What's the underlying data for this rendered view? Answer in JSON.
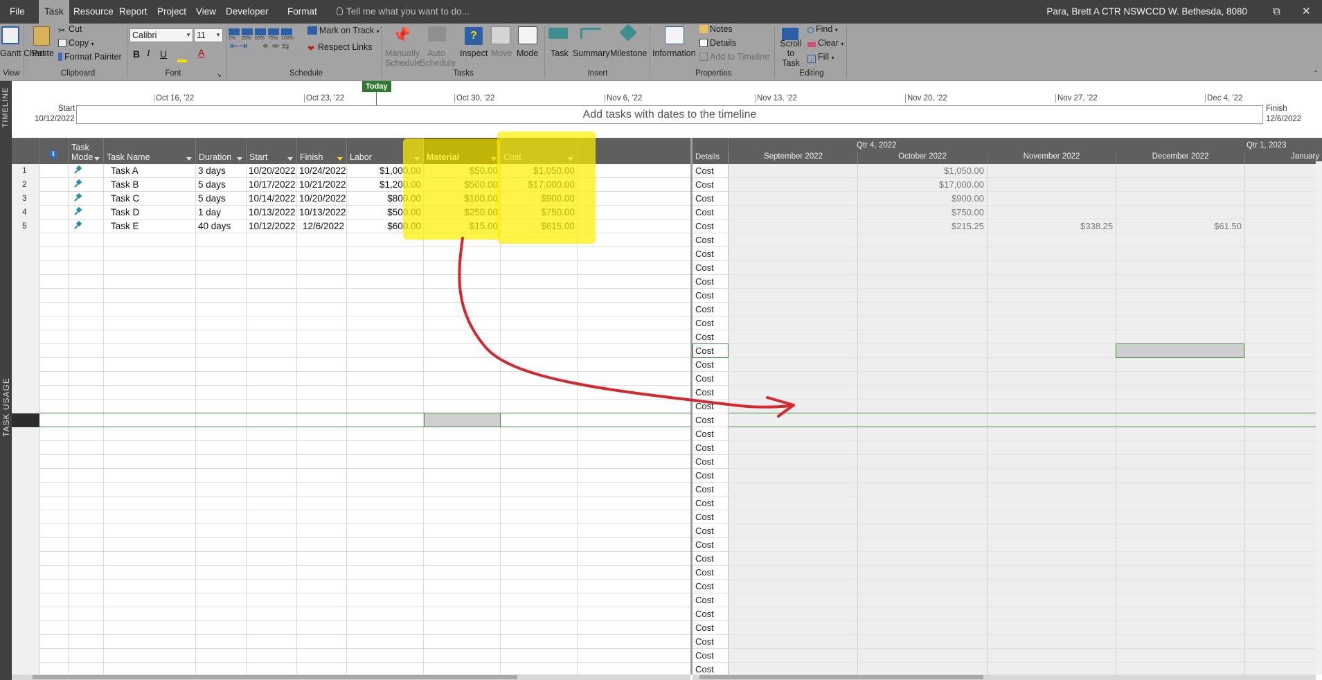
{
  "menu": {
    "items": [
      "File",
      "Task",
      "Resource",
      "Report",
      "Project",
      "View",
      "Developer",
      "Format"
    ],
    "active": "Task",
    "tell_me": "Tell me what you want to do...",
    "user": "Para, Brett A CTR NSWCCD W. Bethesda, 8080"
  },
  "ribbon": {
    "groups": {
      "view": "View",
      "clipboard": "Clipboard",
      "font": "Font",
      "schedule": "Schedule",
      "tasks": "Tasks",
      "insert": "Insert",
      "properties": "Properties",
      "editing": "Editing"
    },
    "gantt_chart": "Gantt Chart",
    "paste": "Paste",
    "cut": "Cut",
    "copy": "Copy",
    "format_painter": "Format Painter",
    "font_name": "Calibri",
    "font_size": "11",
    "mark_on_track": "Mark on Track",
    "respect_links": "Respect Links",
    "manually_schedule": "Manually Schedule",
    "auto_schedule": "Auto Schedule",
    "inspect": "Inspect",
    "move": "Move",
    "mode": "Mode",
    "task": "Task",
    "summary": "Summary",
    "milestone": "Milestone",
    "information": "Information",
    "notes": "Notes",
    "details": "Details",
    "add_to_timeline": "Add to Timeline",
    "scroll_to_task": "Scroll to Task",
    "find": "Find",
    "clear": "Clear",
    "fill": "Fill",
    "bold": "B",
    "italic": "I",
    "underline": "U",
    "font_color": "A",
    "pct": [
      "0%",
      "25%",
      "50%",
      "75%",
      "100%"
    ]
  },
  "timeline": {
    "side_label": "TIMELINE",
    "today": "Today",
    "start_label": "Start",
    "start_date": "10/12/2022",
    "finish_label": "Finish",
    "finish_date": "12/6/2022",
    "placeholder": "Add tasks with dates to the timeline",
    "dates": [
      "Oct 16, '22",
      "Oct 23, '22",
      "Oct 30, '22",
      "Nov 6, '22",
      "Nov 13, '22",
      "Nov 20, '22",
      "Nov 27, '22",
      "Dec 4, '22"
    ]
  },
  "view_label": "TASK USAGE",
  "columns": {
    "task_mode": "Task Mode",
    "task_name": "Task Name",
    "duration": "Duration",
    "start": "Start",
    "finish": "Finish",
    "labor": "Labor",
    "material": "Material",
    "cost": "Cost"
  },
  "tasks": [
    {
      "id": "1",
      "name": "Task A",
      "duration": "3 days",
      "start": "10/20/2022",
      "finish": "10/24/2022",
      "labor": "$1,000.00",
      "material": "$50.00",
      "cost": "$1,050.00"
    },
    {
      "id": "2",
      "name": "Task B",
      "duration": "5 days",
      "start": "10/17/2022",
      "finish": "10/21/2022",
      "labor": "$1,200.00",
      "material": "$500.00",
      "cost": "$17,000.00"
    },
    {
      "id": "3",
      "name": "Task C",
      "duration": "5 days",
      "start": "10/14/2022",
      "finish": "10/20/2022",
      "labor": "$800.00",
      "material": "$100.00",
      "cost": "$900.00"
    },
    {
      "id": "4",
      "name": "Task D",
      "duration": "1 day",
      "start": "10/13/2022",
      "finish": "10/13/2022",
      "labor": "$500.00",
      "material": "$250.00",
      "cost": "$750.00"
    },
    {
      "id": "5",
      "name": "Task E",
      "duration": "40 days",
      "start": "10/12/2022",
      "finish": "12/6/2022",
      "labor": "$600.00",
      "material": "$15.00",
      "cost": "$615.00"
    }
  ],
  "usage": {
    "details_header": "Details",
    "detail_label": "Cost",
    "qtr4": "Qtr 4, 2022",
    "qtr1": "Qtr 1, 2023",
    "months": [
      "September 2022",
      "October 2022",
      "November 2022",
      "December 2022",
      "January"
    ],
    "values": [
      {
        "october": "$1,050.00",
        "november": "",
        "december": ""
      },
      {
        "october": "$17,000.00",
        "november": "",
        "december": ""
      },
      {
        "october": "$900.00",
        "november": "",
        "december": ""
      },
      {
        "october": "$750.00",
        "november": "",
        "december": ""
      },
      {
        "october": "$215.25",
        "november": "$338.25",
        "december": "$61.50"
      }
    ]
  },
  "colors": {
    "highlight": "#ffee00",
    "annotation_arrow": "#d9252b",
    "ribbon": "#a3a3a3",
    "titlebar": "#404040",
    "today": "#2c7a2c"
  }
}
